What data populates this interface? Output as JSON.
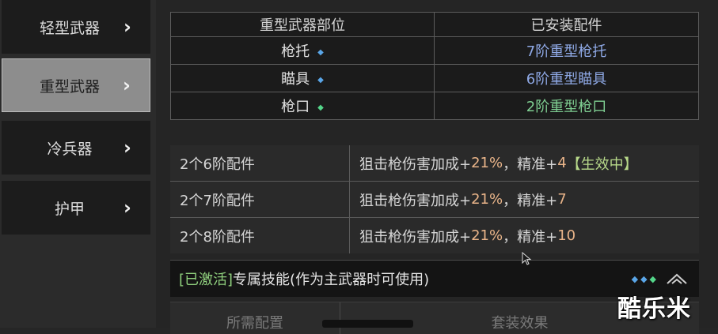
{
  "sidebar": {
    "items": [
      {
        "label": "轻型武器",
        "active": false
      },
      {
        "label": "重型武器",
        "active": true
      },
      {
        "label": "冷兵器",
        "active": false
      },
      {
        "label": "护甲",
        "active": false
      }
    ],
    "chevron": "›"
  },
  "parts_table": {
    "headers": [
      "重型武器部位",
      "已安装配件"
    ],
    "rows": [
      {
        "slot": "枪托",
        "gem_color": "blue",
        "part": "7阶重型枪托"
      },
      {
        "slot": "瞄具",
        "gem_color": "blue",
        "part": "6阶重型瞄具"
      },
      {
        "slot": "枪口",
        "gem_color": "green",
        "part": "2阶重型枪口"
      }
    ]
  },
  "set_bonus": {
    "rows": [
      {
        "condition": "2个6阶配件",
        "effect_prefix": "狙击枪伤害加成+",
        "damage": "21%",
        "effect_mid": "，精准+",
        "precision": "4",
        "status": "【生效中】"
      },
      {
        "condition": "2个7阶配件",
        "effect_prefix": "狙击枪伤害加成+",
        "damage": "21%",
        "effect_mid": "，精准+",
        "precision": "7",
        "status": ""
      },
      {
        "condition": "2个8阶配件",
        "effect_prefix": "狙击枪伤害加成+",
        "damage": "21%",
        "effect_mid": "，精准+",
        "precision": "10",
        "status": ""
      }
    ]
  },
  "skill": {
    "tag": "[已激活]",
    "title": "专属技能(作为主武器时可使用)",
    "dot_colors": [
      "#5aa6e8",
      "#5aa6e8",
      "#54d68a"
    ]
  },
  "sub_table": {
    "headers": [
      "所需配置",
      "套装效果"
    ]
  },
  "watermark": "酷乐米",
  "colors": {
    "accent_blue": "#8fa9e6",
    "accent_green": "#7fcf92",
    "number_orange": "#e9b489",
    "active_tag": "#b8d98a"
  }
}
